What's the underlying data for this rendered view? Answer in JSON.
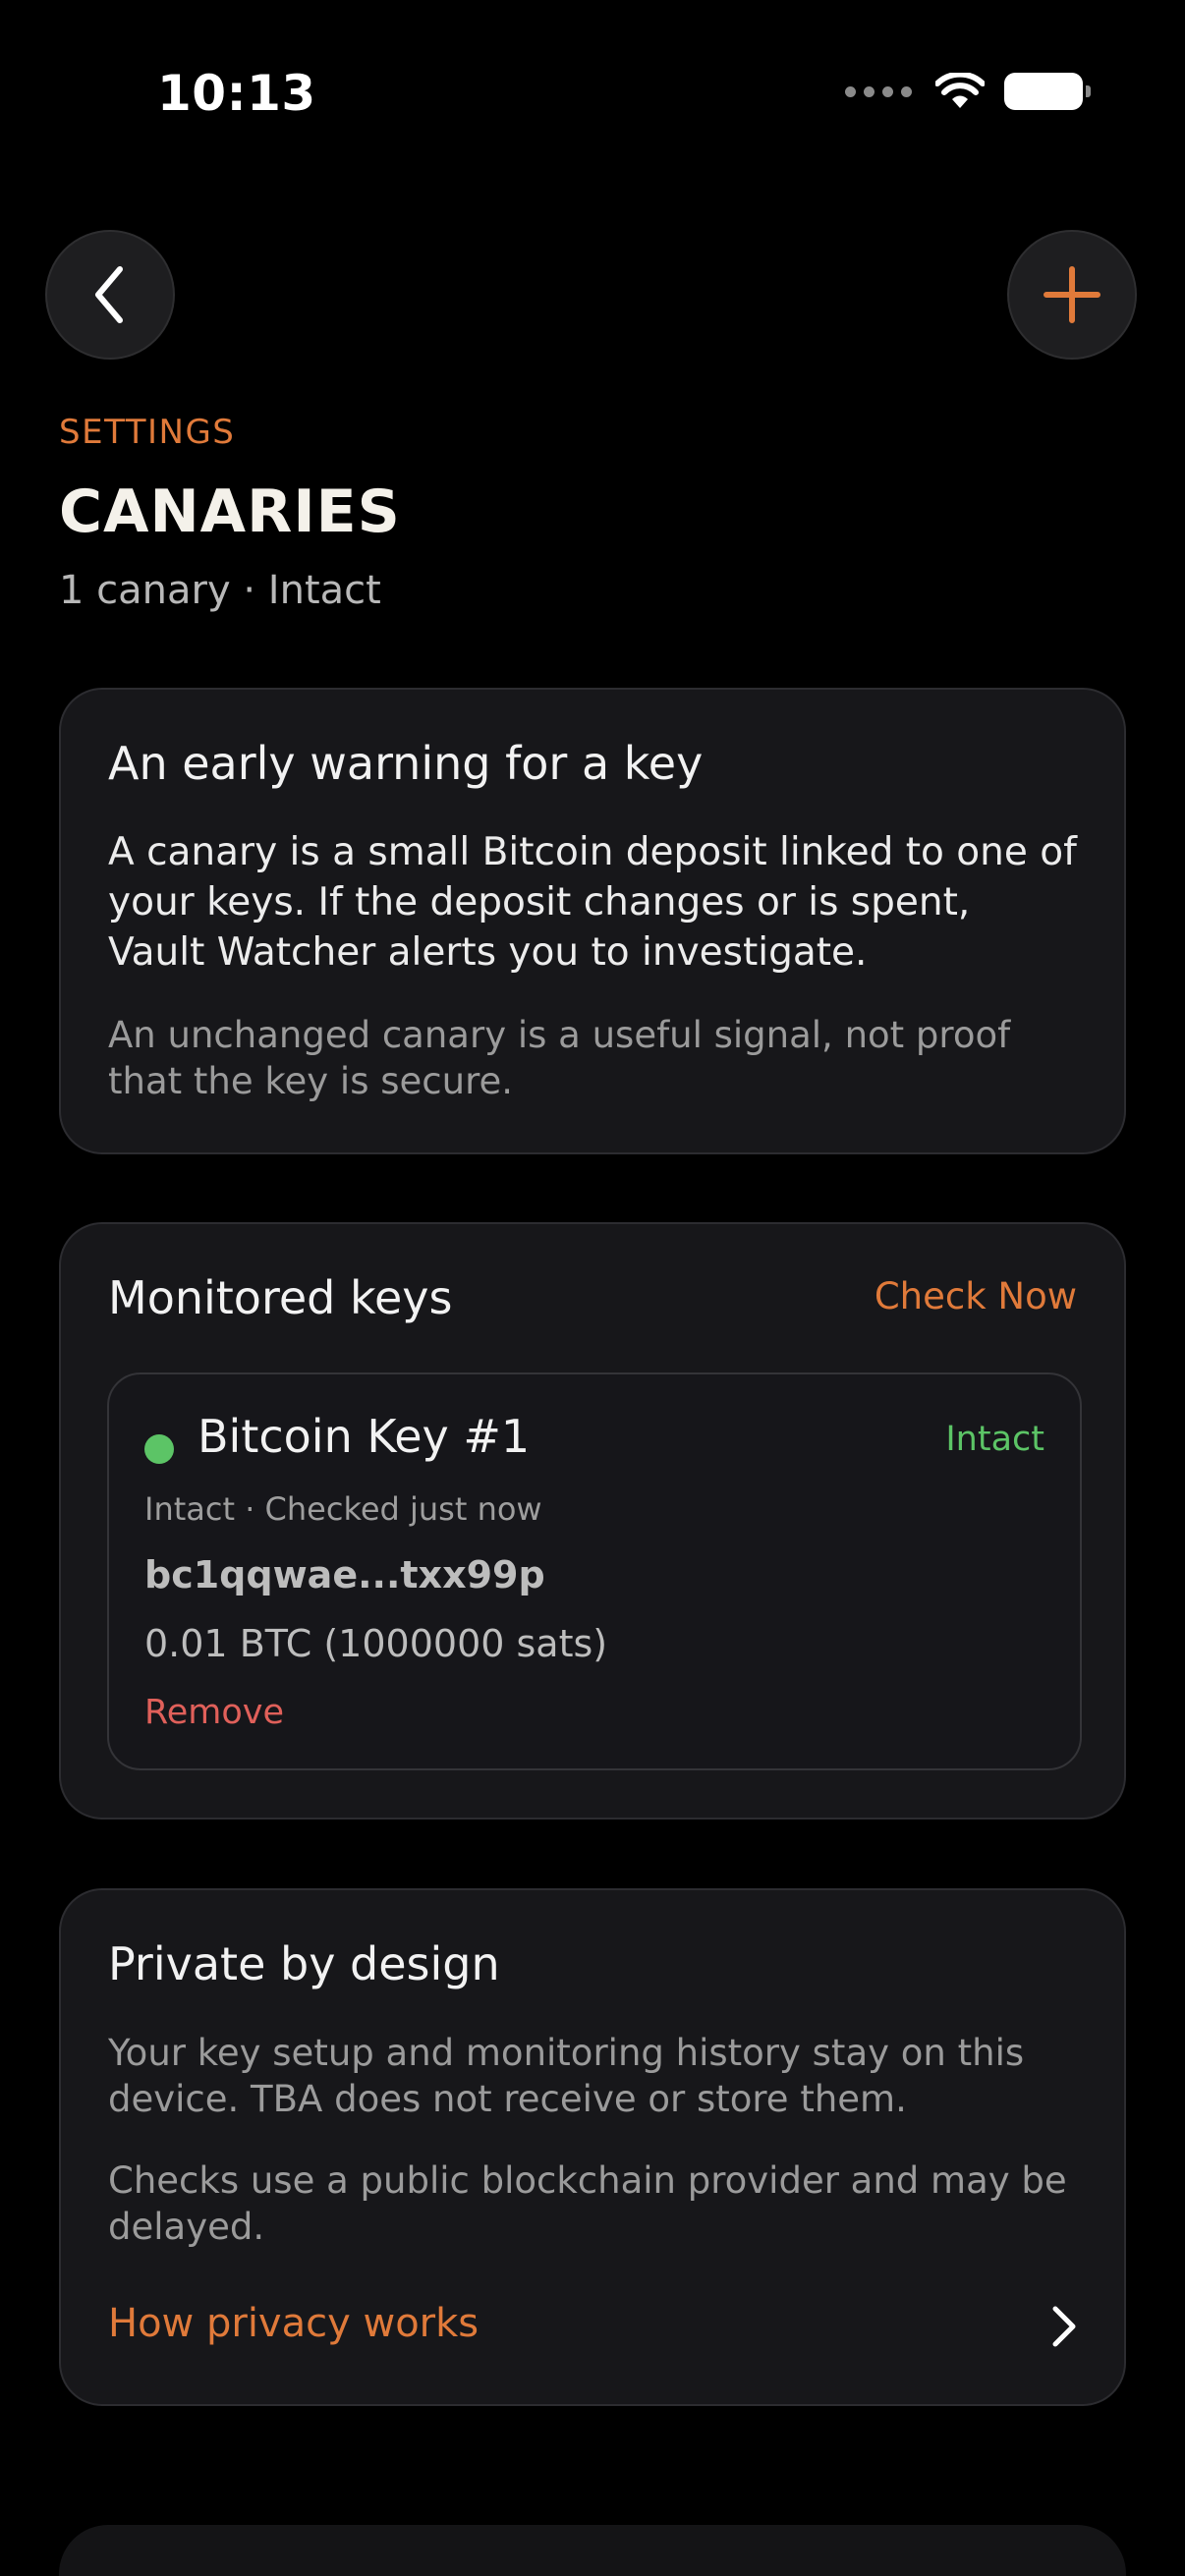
{
  "status_bar": {
    "time": "10:13"
  },
  "header": {
    "eyebrow": "SETTINGS",
    "title": "CANARIES",
    "subtitle": "1 canary · Intact"
  },
  "intro_card": {
    "heading": "An early warning for a key",
    "body": "A canary is a small Bitcoin deposit linked to one of your keys. If the deposit changes or is spent, Vault Watcher alerts you to investigate.",
    "note": "An unchanged canary is a useful signal, not proof that the key is secure."
  },
  "monitored_card": {
    "heading": "Monitored keys",
    "check_now_label": "Check Now",
    "keys": [
      {
        "name": "Bitcoin Key #1",
        "status": "Intact",
        "check_line": "Intact · Checked just now",
        "address": "bc1qqwae...txx99p",
        "amount": "0.01 BTC (1000000 sats)",
        "remove_label": "Remove",
        "status_color": "#5cc466"
      }
    ]
  },
  "privacy_card": {
    "heading": "Private by design",
    "paragraph_1": "Your key setup and monitoring history stay on this device. TBA does not receive or store them.",
    "paragraph_2": "Checks use a public blockchain provider and may be delayed.",
    "link_label": "How privacy works"
  },
  "icons": {
    "back": "chevron-left-icon",
    "add": "plus-icon",
    "wifi": "wifi-icon",
    "battery": "battery-icon",
    "privacy_chevron": "chevron-right-icon"
  },
  "colors": {
    "accent": "#e07a3a",
    "intact": "#5cc466",
    "danger": "#e0605a",
    "card_bg": "#17171a"
  }
}
